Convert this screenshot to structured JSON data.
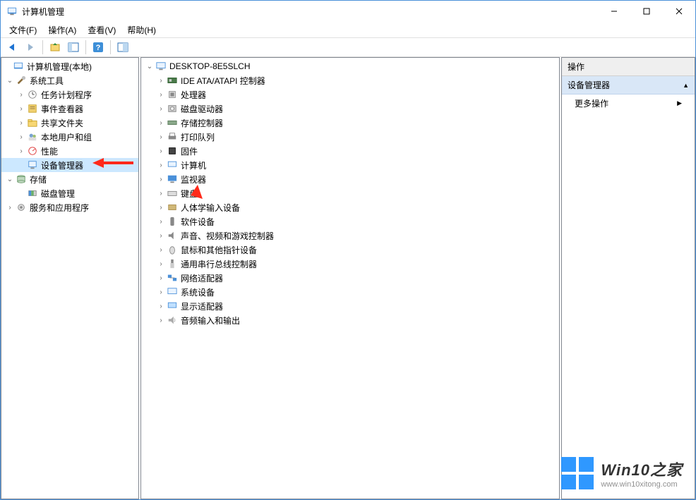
{
  "title": "计算机管理",
  "menus": [
    "文件(F)",
    "操作(A)",
    "查看(V)",
    "帮助(H)"
  ],
  "left_tree": {
    "root": "计算机管理(本地)",
    "groups": [
      {
        "label": "系统工具",
        "expanded": true,
        "children": [
          "任务计划程序",
          "事件查看器",
          "共享文件夹",
          "本地用户和组",
          "性能",
          "设备管理器"
        ],
        "selected_child": "设备管理器"
      },
      {
        "label": "存储",
        "expanded": true,
        "children": [
          "磁盘管理"
        ]
      },
      {
        "label": "服务和应用程序",
        "expanded": false,
        "children": []
      }
    ]
  },
  "device_tree": {
    "root": "DESKTOP-8E5SLCH",
    "categories": [
      "IDE ATA/ATAPI 控制器",
      "处理器",
      "磁盘驱动器",
      "存储控制器",
      "打印队列",
      "固件",
      "计算机",
      "监视器",
      "键盘",
      "人体学输入设备",
      "软件设备",
      "声音、视频和游戏控制器",
      "鼠标和其他指针设备",
      "通用串行总线控制器",
      "网络适配器",
      "系统设备",
      "显示适配器",
      "音频输入和输出"
    ]
  },
  "actions_panel": {
    "header": "操作",
    "section": "设备管理器",
    "more": "更多操作"
  },
  "watermark": {
    "title": "Win10之家",
    "subtitle": "www.win10xitong.com"
  }
}
